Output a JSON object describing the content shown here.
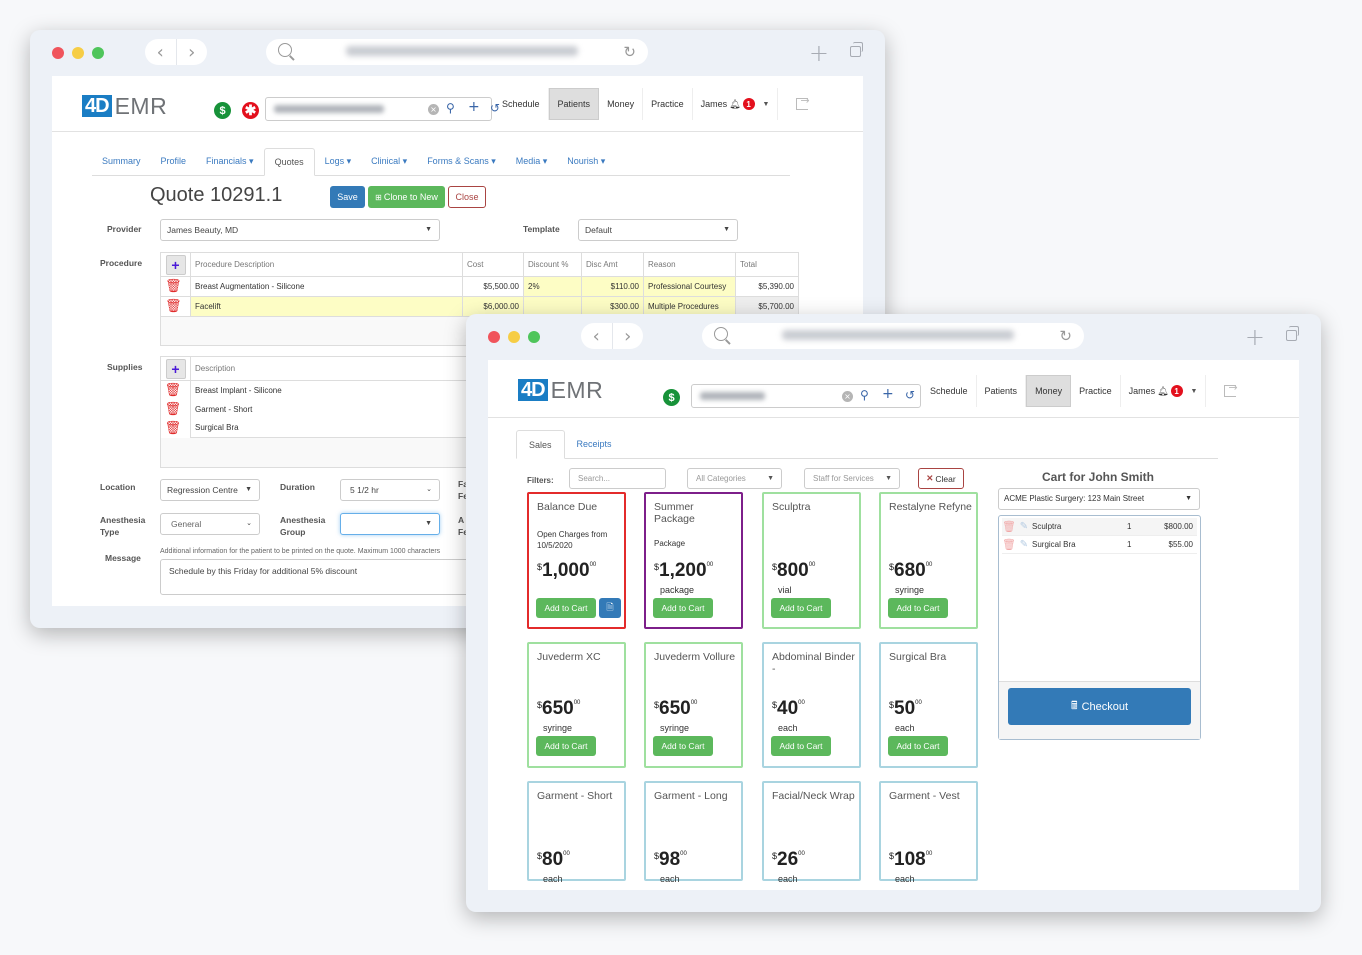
{
  "window_quote": {
    "header": {
      "logo_box": "4D",
      "logo_text": "EMR",
      "dollar_icon": "$",
      "alert_icon": "✱",
      "nav": [
        "Schedule",
        "Patients",
        "Money",
        "Practice"
      ],
      "active_nav": "Patients",
      "user": "James",
      "notification_count": "1"
    },
    "subtabs": [
      "Summary",
      "Profile",
      "Financials ▾",
      "Quotes",
      "Logs ▾",
      "Clinical ▾",
      "Forms & Scans ▾",
      "Media ▾",
      "Nourish ▾"
    ],
    "active_subtab": "Quotes",
    "title": "Quote 10291.1",
    "buttons": {
      "save": "Save",
      "clone": "Clone to New",
      "close": "Close"
    },
    "provider_label": "Provider",
    "provider_value": "James Beauty, MD",
    "template_label": "Template",
    "template_value": "Default",
    "procedure_label": "Procedure",
    "procedure_columns": [
      "Procedure Description",
      "Cost",
      "Discount %",
      "Disc Amt",
      "Reason",
      "Total"
    ],
    "procedures": [
      {
        "description": "Breast Augmentation - Silicone",
        "cost": "$5,500.00",
        "discount_pct": "2%",
        "disc_amt": "$110.00",
        "reason": "Professional Courtesy",
        "total": "$5,390.00"
      },
      {
        "description": "Facelift",
        "cost": "$6,000.00",
        "discount_pct": "",
        "disc_amt": "$300.00",
        "reason": "Multiple Procedures",
        "total": "$5,700.00"
      }
    ],
    "supplies_label": "Supplies",
    "supplies_column": "Description",
    "supplies": [
      "Breast Implant - Silicone",
      "Garment - Short",
      "Surgical Bra"
    ],
    "location_label": "Location",
    "location_value": "Regression Centre",
    "duration_label": "Duration",
    "duration_value": "5 1/2 hr",
    "anesthesia_type_label_1": "Anesthesia",
    "anesthesia_type_label_2": "Type",
    "anesthesia_type_value": "General",
    "anesthesia_group_label_1": "Anesthesia",
    "anesthesia_group_label_2": "Group",
    "anesthesia_group_value": "",
    "cut_labels": [
      "Fa",
      "Fe",
      "A",
      "Fe"
    ],
    "message_label": "Message",
    "message_hint": "Additional information for the patient to be printed on the quote. Maximum 1000 characters",
    "message_value": "Schedule by this Friday for additional 5% discount"
  },
  "window_sales": {
    "header": {
      "logo_box": "4D",
      "logo_text": "EMR",
      "dollar_icon": "$",
      "nav": [
        "Schedule",
        "Patients",
        "Money",
        "Practice"
      ],
      "active_nav": "Money",
      "user": "James",
      "notification_count": "1"
    },
    "tabs": [
      "Sales",
      "Receipts"
    ],
    "active_tab": "Sales",
    "filters_label": "Filters:",
    "search_placeholder": "Search...",
    "categories_value": "All Categories",
    "staff_value": "Staff for Services",
    "clear_label": "Clear",
    "products": [
      {
        "name": "Balance Due",
        "desc": "Open Charges from 10/5/2020",
        "dollars": "1,000",
        "cents": "00",
        "unit": "",
        "button": "Add to Cart",
        "style": "red"
      },
      {
        "name": "Summer Package",
        "desc": "Package",
        "dollars": "1,200",
        "cents": "00",
        "unit": "package",
        "button": "Add to Cart",
        "style": "purple"
      },
      {
        "name": "Sculptra",
        "desc": "",
        "dollars": "800",
        "cents": "00",
        "unit": "vial",
        "button": "Add to Cart",
        "style": "green"
      },
      {
        "name": "Restalyne Refyne",
        "desc": "",
        "dollars": "680",
        "cents": "00",
        "unit": "syringe",
        "button": "Add to Cart",
        "style": "green"
      },
      {
        "name": "Juvederm XC",
        "desc": "",
        "dollars": "650",
        "cents": "00",
        "unit": "syringe",
        "button": "Add to Cart",
        "style": "green"
      },
      {
        "name": "Juvederm Vollure",
        "desc": "",
        "dollars": "650",
        "cents": "00",
        "unit": "syringe",
        "button": "Add to Cart",
        "style": "green"
      },
      {
        "name": "Abdominal Binder -",
        "desc": "",
        "dollars": "40",
        "cents": "00",
        "unit": "each",
        "button": "Add to Cart",
        "style": "teal"
      },
      {
        "name": "Surgical Bra",
        "desc": "",
        "dollars": "50",
        "cents": "00",
        "unit": "each",
        "button": "Add to Cart",
        "style": "teal"
      },
      {
        "name": "Garment - Short",
        "desc": "",
        "dollars": "80",
        "cents": "00",
        "unit": "each",
        "button": "",
        "style": "teal"
      },
      {
        "name": "Garment - Long",
        "desc": "",
        "dollars": "98",
        "cents": "00",
        "unit": "each",
        "button": "",
        "style": "teal"
      },
      {
        "name": "Facial/Neck Wrap",
        "desc": "",
        "dollars": "26",
        "cents": "00",
        "unit": "each",
        "button": "",
        "style": "teal"
      },
      {
        "name": "Garment - Vest",
        "desc": "",
        "dollars": "108",
        "cents": "00",
        "unit": "each",
        "button": "",
        "style": "teal"
      }
    ],
    "currency_symbol": "$",
    "cart": {
      "title": "Cart for John Smith",
      "location": "ACME Plastic Surgery: 123 Main Street",
      "items": [
        {
          "name": "Sculptra",
          "qty": "1",
          "price": "$800.00"
        },
        {
          "name": "Surgical Bra",
          "qty": "1",
          "price": "$55.00"
        }
      ],
      "checkout_label": "Checkout"
    }
  }
}
